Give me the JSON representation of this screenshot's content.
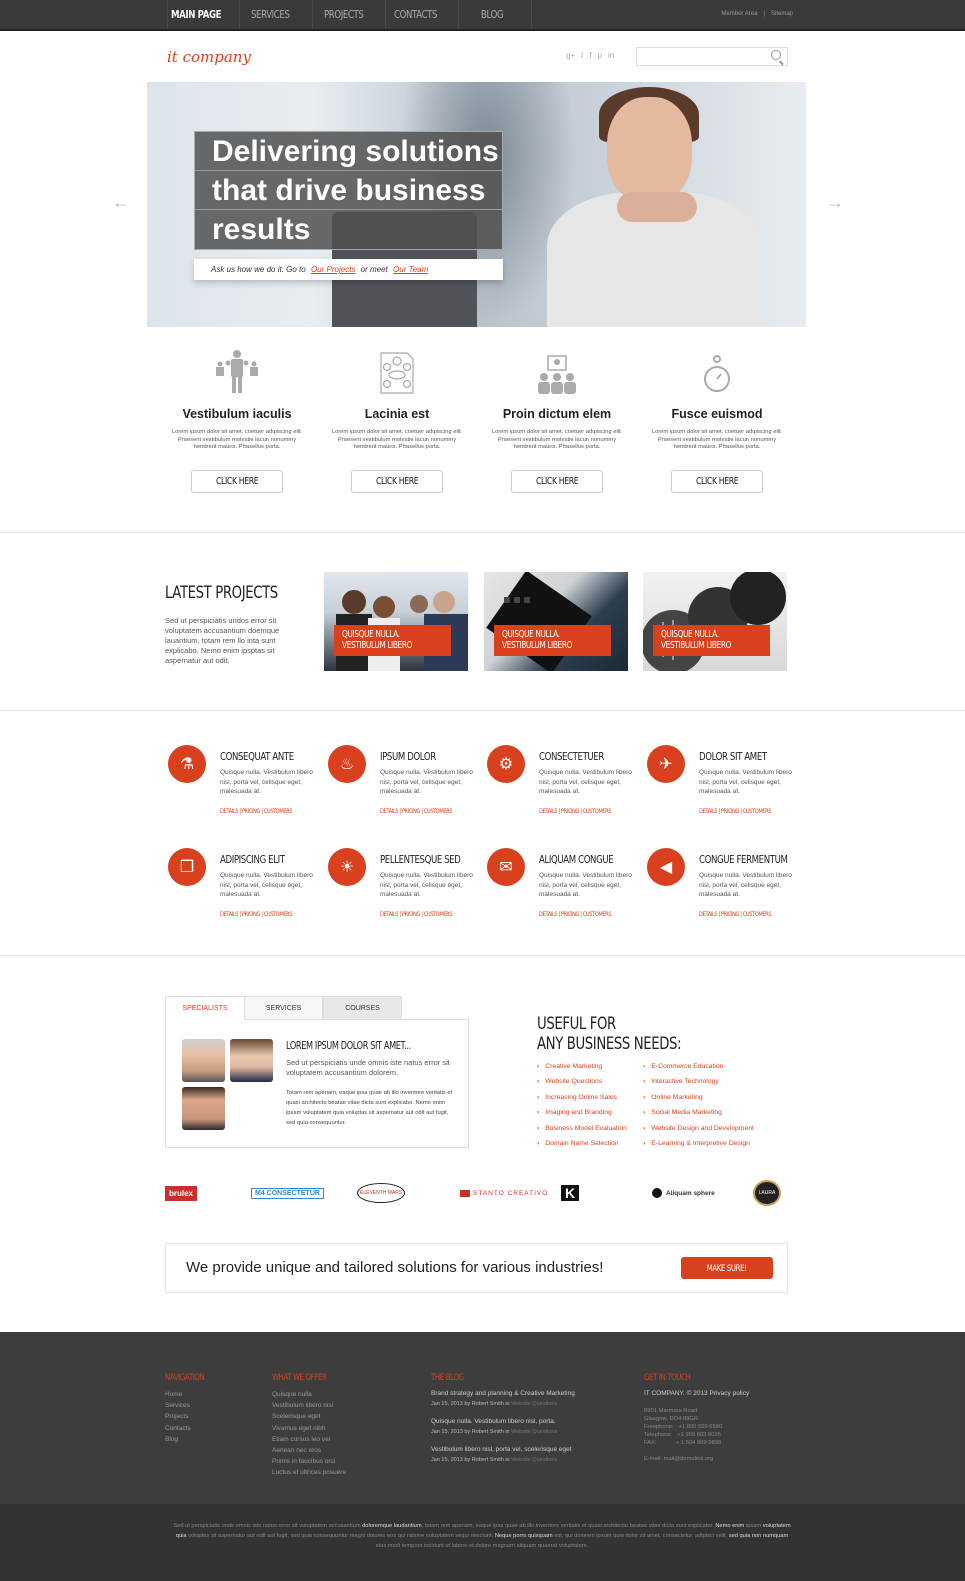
{
  "topbar": {
    "nav": [
      "MAIN PAGE",
      "SERVICES",
      "PROJECTS",
      "CONTACTS",
      "BLOG"
    ],
    "links": [
      "Member Area",
      "Sitemap"
    ],
    "separator": "|"
  },
  "header": {
    "logo": "it company",
    "socials": [
      "google-plus-icon",
      "twitter-icon",
      "facebook-icon",
      "pinterest-icon",
      "linkedin-icon"
    ],
    "social_glyphs": [
      "g+",
      "t",
      "f",
      "p",
      "in"
    ],
    "search_placeholder": ""
  },
  "hero": {
    "title_lines": [
      "Delivering solutions",
      "that drive business",
      "results"
    ],
    "sub_prefix": "Ask us how we do it. Go to",
    "link1": "Our Projects",
    "sub_mid": "or meet",
    "link2": "Our Team",
    "prev": "←",
    "next": "→"
  },
  "features": [
    {
      "icon": "team-icon",
      "title": "Vestibulum iaculis",
      "text": "Lorem ipsum dolor sit amet, coetuer adipiscing elit. Praesent vestibulum molestie lacun nonummy hendrerit mauris. Phasellus porta.",
      "button": "CLICK HERE"
    },
    {
      "icon": "diagram-icon",
      "title": "Lacinia est",
      "text": "Lorem ipsum dolor sit amet, coetuer adipiscing elit. Praesent vestibulum molestie lacun nonummy hendrerit mauris. Phasellus porta.",
      "button": "CLICK HERE"
    },
    {
      "icon": "presentation-icon",
      "title": "Proin dictum elem",
      "text": "Lorem ipsum dolor sit amet, coetuer adipiscing elit. Praesent vestibulum molestie lacun nonummy hendrerit mauris. Phasellus porta.",
      "button": "CLICK HERE"
    },
    {
      "icon": "stopwatch-icon",
      "title": "Fusce euismod",
      "text": "Lorem ipsum dolor sit amet, coetuer adipiscing elit. Praesent vestibulum molestie lacun nonummy hendrerit mauris. Phasellus porta.",
      "button": "CLICK HERE"
    }
  ],
  "latest_projects": {
    "title": "LATEST PROJECTS",
    "text": "Sed ut perspiciatis undos error sit voluptatem accusantium doemque lauantium, totam rem llo inta sunt explicabo. Nemo enim ipsptas sit aspernatur aut odit.",
    "items": [
      {
        "caption1": "QUISQUE NULLA.",
        "caption2": "VESTIBULUM LIBERO"
      },
      {
        "caption1": "QUISQUE NULLA.",
        "caption2": "VESTIBULUM LIBERO"
      },
      {
        "caption1": "QUISQUE NULLA.",
        "caption2": "VESTIBULUM LIBERO"
      }
    ]
  },
  "services": [
    {
      "icon": "flask-icon",
      "glyph": "⚗",
      "title": "CONSEQUAT ANTE",
      "text": "Quisque nulla. Vestibulum libero nisl, porta vel, celisque eget, malesuada at.",
      "links": [
        "DETAILS",
        "PRICING",
        "CUSTOMERS"
      ]
    },
    {
      "icon": "flame-icon",
      "glyph": "♨",
      "title": "IPSUM DOLOR",
      "text": "Quisque nulla. Vestibulum libero nisl, porta vel, celisque eget, malesuada at.",
      "links": [
        "DETAILS",
        "PRICING",
        "CUSTOMERS"
      ]
    },
    {
      "icon": "gears-icon",
      "glyph": "⚙",
      "title": "CONSECTETUER",
      "text": "Quisque nulla. Vestibulum libero nisl, porta vel, celisque eget, malesuada at.",
      "links": [
        "DETAILS",
        "PRICING",
        "CUSTOMERS"
      ]
    },
    {
      "icon": "airplane-icon",
      "glyph": "✈",
      "title": "DOLOR SIT AMET",
      "text": "Quisque nulla. Vestibulum libero nisl, porta vel, celisque eget, malesuada at.",
      "links": [
        "DETAILS",
        "PRICING",
        "CUSTOMERS"
      ]
    },
    {
      "icon": "documents-icon",
      "glyph": "❐",
      "title": "ADIPISCING ELIT",
      "text": "Quisque nulla. Vestibulum libero nisl, porta vel, celisque eget, malesuada at.",
      "links": [
        "DETAILS",
        "PRICING",
        "CUSTOMERS"
      ]
    },
    {
      "icon": "lightbulb-icon",
      "glyph": "☀",
      "title": "PELLENTESQUE SED",
      "text": "Quisque nulla. Vestibulum libero nisl, porta vel, celisque eget, malesuada at.",
      "links": [
        "DETAILS",
        "PRICING",
        "CUSTOMERS"
      ]
    },
    {
      "icon": "chat-bubbles-icon",
      "glyph": "✉",
      "title": "ALIQUAM CONGUE",
      "text": "Quisque nulla. Vestibulum libero nisl, porta vel, celisque eget, malesuada at.",
      "links": [
        "DETAILS",
        "PRICING",
        "CUSTOMERS"
      ]
    },
    {
      "icon": "megaphone-icon",
      "glyph": "◀",
      "title": "CONGUE FERMENTUM",
      "text": "Quisque nulla. Vestibulum libero nisl, porta vel, celisque eget, malesuada at.",
      "links": [
        "DETAILS",
        "PRICING",
        "CUSTOMERS"
      ]
    }
  ],
  "tabs": {
    "labels": [
      "SPECIALISTS",
      "SERVICES",
      "COURSES"
    ],
    "active": "SPECIALISTS",
    "heading": "LOREM IPSUM DOLOR SIT AMET...",
    "lead": "Sed ut perspiciatis unde omnis iste natus error sit voluptatem accusantium dolorem.",
    "body": "Totam rem aperiam, eaque ipsa quae ab illo inventore veritatis et quasi architecto beatae vitae dicta sunt explicabo. Nemo enim ipsam voluptatem quia voluptas sit aspernatur aut odit aut fugit, sed quia consequuntur."
  },
  "useful": {
    "title_line1": "USEFUL FOR",
    "title_line2": "ANY BUSINESS NEEDS:",
    "col1": [
      "Creative Marketing",
      "Website Questions",
      "Increasing Online Sales",
      "Imaging and Branding",
      "Business Model Evaluation",
      "Domain Name Selection"
    ],
    "col2": [
      "E-Commerce Education",
      "Interactive Technology",
      "Online Marketing",
      "Social Media Marketing",
      "Website Design and Development",
      "E-Learning & Interpretive Design"
    ]
  },
  "partners": [
    "brulex",
    "M4 CONSECTETUR",
    "ELEVENTH MARS",
    "STANTO CREATIVO",
    "K",
    "Aliquam sphere",
    "LAURA"
  ],
  "cta": {
    "text": "We provide unique and tailored solutions for various industries!",
    "button": "MAKE SURE!"
  },
  "footer": {
    "navigation": {
      "title": "NAVIGATION",
      "items": [
        "Home",
        "Services",
        "Projects",
        "Contacts",
        "Blog"
      ]
    },
    "offer": {
      "title": "WHAT WE OFFER",
      "items": [
        "Quisque nulla",
        "Vestibulum libero nisl",
        "Scelerisque eget",
        "Vivamus eget nibh",
        "Etiam cursus leo vel",
        "Aenean nec eros",
        "Primis in faucibus orci",
        "Luctus et ultrices posuere"
      ]
    },
    "blog": {
      "title": "THE BLOG",
      "posts": [
        {
          "title": "Brand strategy and planning & Creative Marketing",
          "date": "Jan 15, 2013 by",
          "author": "Robert Smith",
          "in": "in",
          "category": "Website Questions"
        },
        {
          "title": "Quisque nulla. Vestibulum libero nisl, porta.",
          "date": "Jan 15, 2013 by",
          "author": "Robert Smith",
          "in": "in",
          "category": "Website Questions"
        },
        {
          "title": "Vestibulum libero nisl, porta vel, scelerisque eget",
          "date": "Jan 15, 2013 by",
          "author": "Robert Smith",
          "in": "in",
          "category": "Website Questions"
        }
      ]
    },
    "contact": {
      "title": "GET IN TOUCH",
      "line": "IT COMPANY. © 2013 Privacy policy",
      "address": [
        "8901 Marmora Road",
        "Glasgow, DO4 89GR.",
        "Freephone:   +1 800 559 6580",
        "Telephone:   +1 959 603 6035",
        "FAX:            + 1 504 889 9898"
      ],
      "email": "E-mail: mail@demolink.org"
    },
    "bottom": {
      "p1": "Sed ut perspiciatis unde omnis iste natus error sit voluptatem accusantium ",
      "b1": "doloremque laudantium",
      "p2": ", totam rem aperiam, eaque ipsa quae ab illo inventore veritatis et quasi architecto beatae vitae dicta sunt explicabo. ",
      "b2": "Nemo enim",
      "p3": " ipsam ",
      "b3": "voluptatem quia",
      "p4": " voluptas sit aspernatur aut odit aut fugit, sed quia consequuntur magni dolores eos qui ratione voluptatem sequi nesciunt. ",
      "b4": "Neque porro quisquam",
      "p5": " est, qui dolorem ipsum quia dolor sit amet, consectetur, adipisci velit, ",
      "b5": "sed quia non numquam",
      "p6": " eius modi tempora incidunt ut labore et dolore magnam aliquam quaerat voluptatem."
    }
  },
  "colors": {
    "accent": "#d9401e",
    "topbar": "#3a3a3a",
    "footer": "#3d3d3d",
    "bottombar": "#333333"
  }
}
